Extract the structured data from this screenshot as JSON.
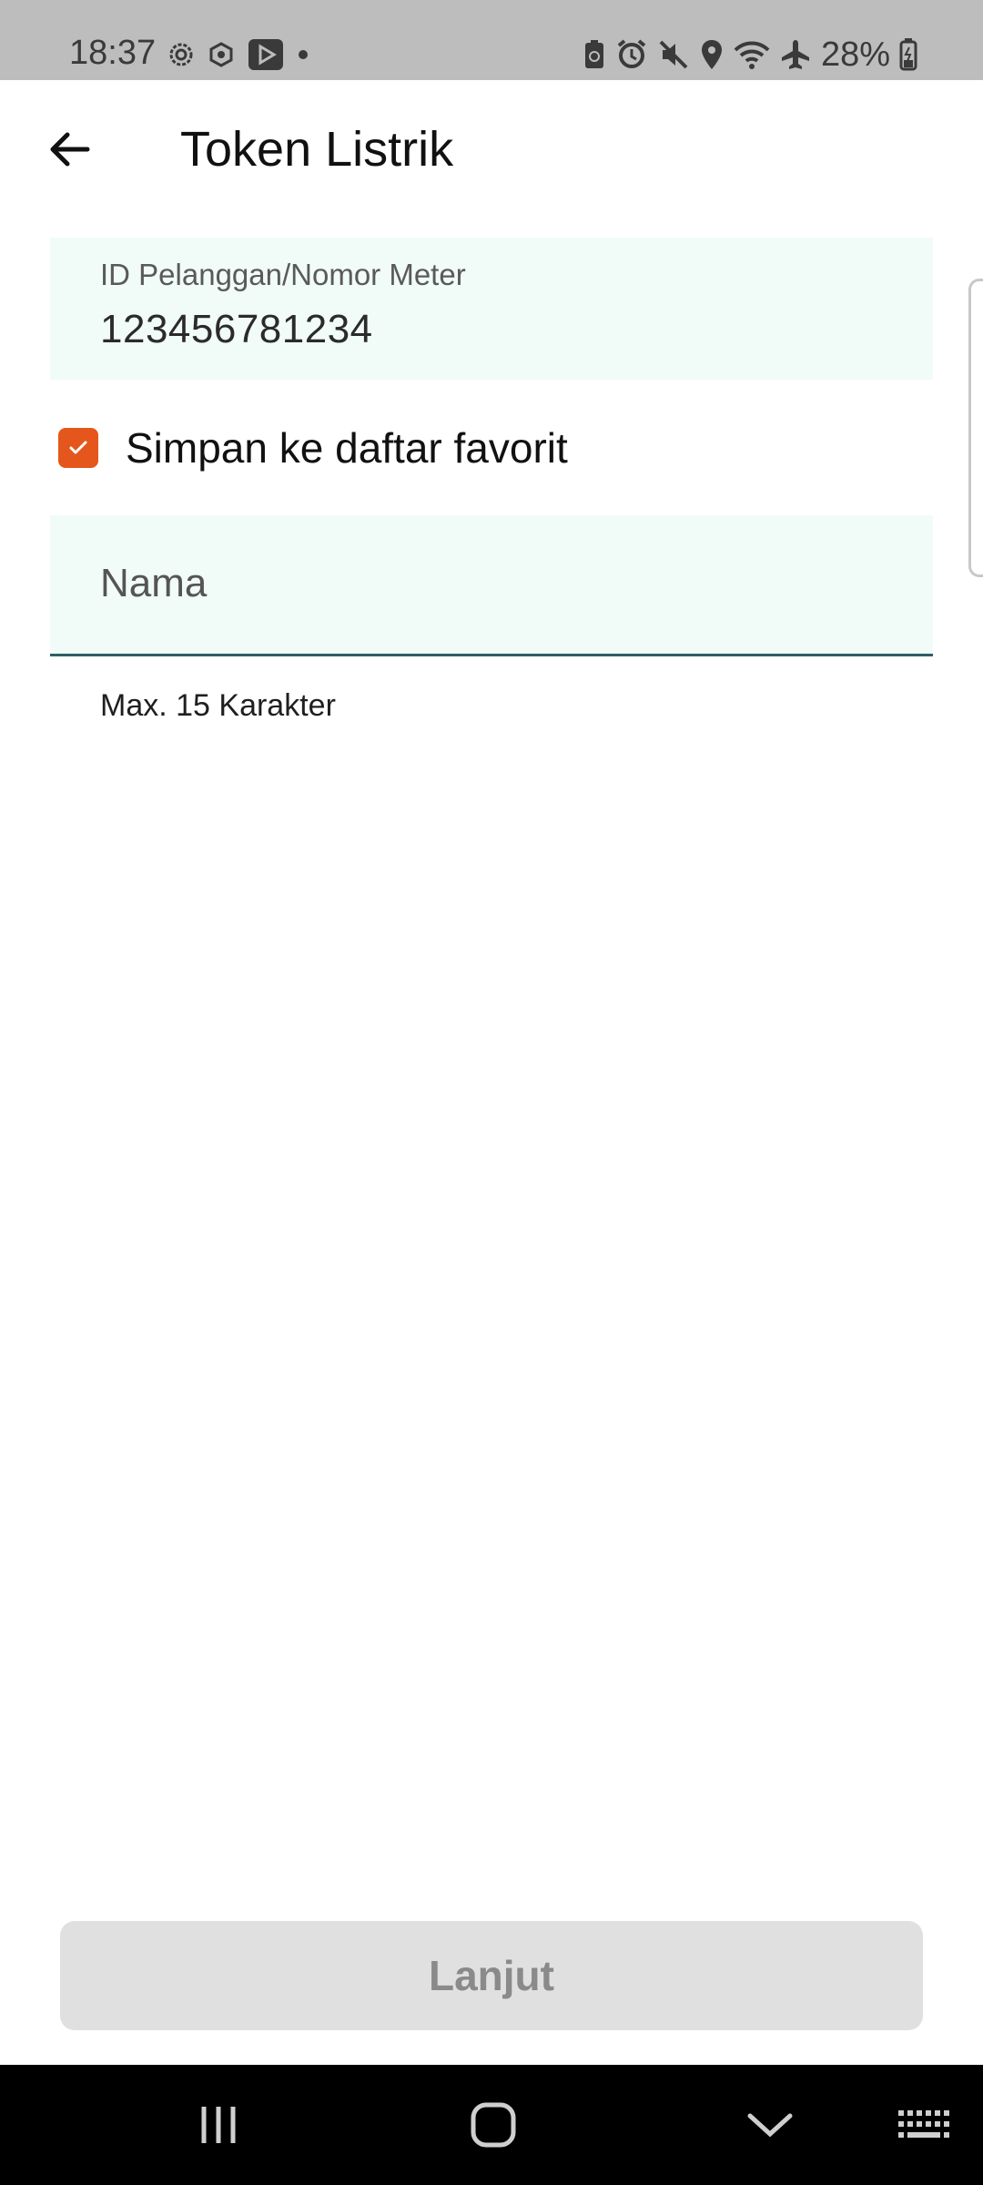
{
  "status_bar": {
    "time": "18:37",
    "battery_text": "28%",
    "left_icons": [
      "settings-gear-icon",
      "network-icon",
      "video-app-icon",
      "dot-icon"
    ],
    "right_icons": [
      "battery-saver-icon",
      "alarm-icon",
      "mute-icon",
      "location-icon",
      "wifi-icon",
      "airplane-icon",
      "battery-icon"
    ]
  },
  "app_bar": {
    "title": "Token Listrik",
    "back_icon": "arrow-left-icon"
  },
  "form": {
    "id_label": "ID Pelanggan/Nomor Meter",
    "id_value": "123456781234",
    "favorite_label": "Simpan ke daftar favorit",
    "favorite_checked": true,
    "name_placeholder": "Nama",
    "name_helper": "Max. 15 Karakter"
  },
  "actions": {
    "next_label": "Lanjut"
  },
  "colors": {
    "accent_orange": "#e5561c",
    "field_bg": "#f1fbf8",
    "underline": "#2f5f63",
    "button_disabled_bg": "#e0e0e0",
    "button_disabled_text": "#8a8a8a"
  },
  "nav_bar": {
    "items": [
      "recent-apps-icon",
      "home-icon",
      "back-chevron-icon",
      "keyboard-icon"
    ]
  }
}
